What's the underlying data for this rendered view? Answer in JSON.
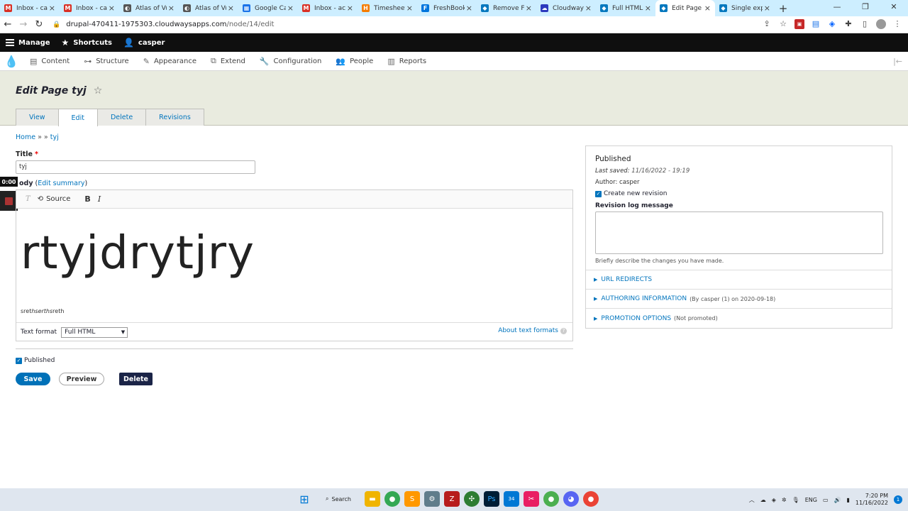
{
  "browser": {
    "tabs": [
      {
        "title": "Inbox - cas",
        "fav": "M",
        "color": "#d93025"
      },
      {
        "title": "Inbox - cas",
        "fav": "M",
        "color": "#d93025"
      },
      {
        "title": "Atlas of Vu",
        "fav": "◐",
        "color": "#555555"
      },
      {
        "title": "Atlas of Vu",
        "fav": "◐",
        "color": "#555555"
      },
      {
        "title": "Google Ca",
        "fav": "▦",
        "color": "#1a73e8"
      },
      {
        "title": "Inbox - acc",
        "fav": "M",
        "color": "#d93025"
      },
      {
        "title": "Timesheet",
        "fav": "H",
        "color": "#f57c00"
      },
      {
        "title": "FreshBook",
        "fav": "F",
        "color": "#0075dd"
      },
      {
        "title": "Remove Fo",
        "fav": "◆",
        "color": "#0678be"
      },
      {
        "title": "Cloudways",
        "fav": "☁",
        "color": "#2c39bd"
      },
      {
        "title": "Full HTML",
        "fav": "◆",
        "color": "#0678be"
      },
      {
        "title": "Edit Page t",
        "fav": "◆",
        "color": "#0678be",
        "active": true
      },
      {
        "title": "Single expo",
        "fav": "◆",
        "color": "#0678be"
      }
    ],
    "url_host": "drupal-470411-1975303.cloudwaysapps.com",
    "url_path": "/node/14/edit"
  },
  "toolbar": {
    "manage": "Manage",
    "shortcuts": "Shortcuts",
    "user": "casper"
  },
  "tray": {
    "items": [
      "Content",
      "Structure",
      "Appearance",
      "Extend",
      "Configuration",
      "People",
      "Reports"
    ],
    "icons": [
      "content-icon",
      "structure-icon",
      "appearance-icon",
      "extend-icon",
      "configuration-icon",
      "people-icon",
      "reports-icon"
    ]
  },
  "header": {
    "title": "Edit Page tyj",
    "tabs": [
      "View",
      "Edit",
      "Delete",
      "Revisions"
    ]
  },
  "breadcrumb": {
    "home": "Home",
    "sep": " » » ",
    "current": "tyj"
  },
  "form": {
    "title_label": "Title",
    "title_value": "tyj",
    "body_label_prefix": "ody",
    "body_label_link": "Edit summary",
    "toolbar_source": "Source",
    "toolbar_bold": "B",
    "toolbar_italic": "I",
    "toolbar_clear": "T",
    "body_big": "rtyjdrytjry",
    "body_small_1": "sret",
    "body_small_2": "hserths",
    "body_small_3": "reth",
    "text_format_label": "Text format",
    "text_format_value": "Full HTML",
    "about_formats": "About text formats",
    "published_label": "Published",
    "save": "Save",
    "preview": "Preview",
    "delete": "Delete"
  },
  "recorder": {
    "time": "0:00"
  },
  "meta": {
    "status": "Published",
    "last_saved_label": "Last saved:",
    "last_saved_value": "11/16/2022 - 19:19",
    "author_label": "Author:",
    "author_value": "casper",
    "create_revision": "Create new revision",
    "revision_log_label": "Revision log message",
    "revision_help": "Briefly describe the changes you have made.",
    "details": [
      {
        "label": "URL REDIRECTS",
        "summary": ""
      },
      {
        "label": "AUTHORING INFORMATION",
        "summary": "(By casper (1) on 2020-09-18)"
      },
      {
        "label": "PROMOTION OPTIONS",
        "summary": "(Not promoted)"
      }
    ]
  },
  "taskbar": {
    "search": "Search",
    "lang": "ENG",
    "time": "7:20 PM",
    "date": "11/16/2022",
    "badge_count": "34"
  }
}
